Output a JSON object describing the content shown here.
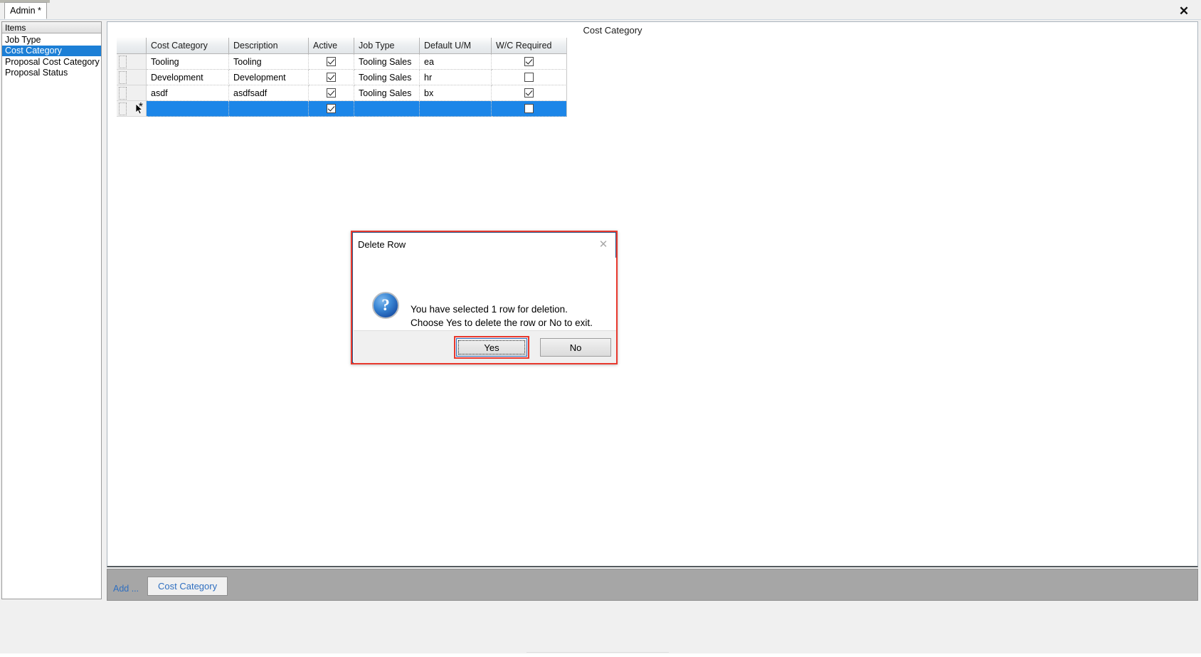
{
  "window": {
    "tab_label": "Admin *",
    "close_icon": "close-icon"
  },
  "sidebar": {
    "header": "Items",
    "items": [
      {
        "label": "Job Type",
        "selected": false
      },
      {
        "label": "Cost Category",
        "selected": true
      },
      {
        "label": "Proposal Cost Category",
        "selected": false
      },
      {
        "label": "Proposal Status",
        "selected": false
      }
    ]
  },
  "main": {
    "title": "Cost Category",
    "grid": {
      "columns": [
        "Cost Category",
        "Description",
        "Active",
        "Job Type",
        "Default U/M",
        "W/C Required"
      ],
      "rows": [
        {
          "cost_category": "Tooling",
          "description": "Tooling",
          "active": true,
          "job_type": "Tooling Sales",
          "default_um": "ea",
          "wc_required": true,
          "selected": false
        },
        {
          "cost_category": "Development",
          "description": "Development",
          "active": true,
          "job_type": "Tooling Sales",
          "default_um": "hr",
          "wc_required": false,
          "selected": false
        },
        {
          "cost_category": "asdf",
          "description": "asdfsadf",
          "active": true,
          "job_type": "Tooling Sales",
          "default_um": "bx",
          "wc_required": true,
          "selected": false
        },
        {
          "cost_category": "",
          "description": "",
          "active": true,
          "job_type": "",
          "default_um": "",
          "wc_required": false,
          "selected": true
        }
      ],
      "new_row_indicator": "*"
    }
  },
  "bottom_toolbar": {
    "add_label": "Add ...",
    "tab_label": "Cost Category"
  },
  "dialog": {
    "title": "Delete Row",
    "close_icon": "close-icon",
    "icon": "question-icon",
    "icon_glyph": "?",
    "message_line1": "You have selected 1 row for deletion.",
    "message_line2": "Choose Yes to delete the row or No to exit.",
    "yes_label": "Yes",
    "no_label": "No"
  },
  "colors": {
    "selection_blue": "#1c86e8",
    "sidebar_selection_blue": "#1c7fd6",
    "highlight_red": "#e8392e",
    "link_blue": "#2f6fc0",
    "toolbar_gray": "#a6a6a6"
  }
}
